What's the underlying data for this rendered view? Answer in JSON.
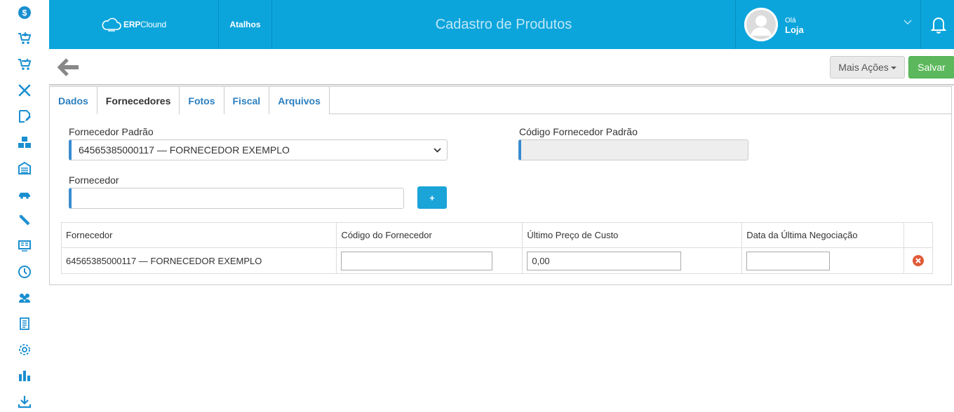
{
  "app": {
    "logo_strong": "ERP",
    "logo_rest": "Clound",
    "shortcuts_label": "Atalhos",
    "page_title": "Cadastro de Produtos",
    "greeting": "Olá",
    "user_name": "Loja"
  },
  "sidebar": {
    "icons": [
      "dollar-icon",
      "cart-add-icon",
      "cart-check-icon",
      "tools-icon",
      "edit-note-icon",
      "boxes-icon",
      "warehouse-icon",
      "car-icon",
      "pencil-icon",
      "monitor-icon",
      "clock-icon",
      "users-icon",
      "report-icon",
      "gear-icon",
      "bar-chart-icon",
      "download-icon"
    ]
  },
  "toolbar": {
    "more_actions_label": "Mais Ações",
    "save_label": "Salvar"
  },
  "tabs": [
    "Dados",
    "Fornecedores",
    "Fotos",
    "Fiscal",
    "Arquivos"
  ],
  "active_tab": "Fornecedores",
  "form": {
    "default_supplier_label": "Fornecedor Padrão",
    "default_supplier_value": "64565385000117 — FORNECEDOR EXEMPLO",
    "default_supplier_code_label": "Código Fornecedor Padrão",
    "default_supplier_code_value": "",
    "supplier_label": "Fornecedor",
    "supplier_value": "",
    "add_label": "+"
  },
  "table": {
    "headers": [
      "Fornecedor",
      "Código do Fornecedor",
      "Último Preço de Custo",
      "Data da Última Negociação"
    ],
    "rows": [
      {
        "supplier": "64565385000117 — FORNECEDOR EXEMPLO",
        "code": "",
        "last_cost": "0,00",
        "last_date": ""
      }
    ]
  },
  "colors": {
    "header_bg": "#0ba5dc",
    "save_green": "#5cb85c",
    "tab_link": "#2a7fbf",
    "sidebar_icon": "#1a8fd0",
    "delete_red": "#e05a38"
  }
}
